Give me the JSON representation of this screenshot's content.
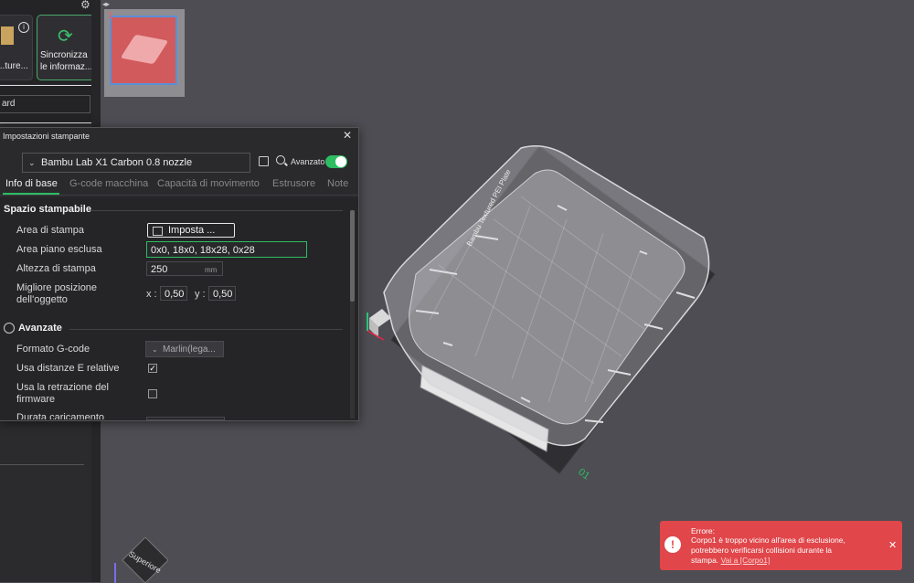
{
  "sidebar": {
    "texture_button_label": "...ture...",
    "sync_button": {
      "line1": "Sincronizza",
      "line2": "le informaz..."
    },
    "name_field_value": "ard"
  },
  "plate": {
    "number": "1"
  },
  "dialog": {
    "title": "Impostazioni stampante",
    "preset": "Bambu Lab X1 Carbon 0.8 nozzle",
    "advanced_label": "Avanzato",
    "advanced_enabled": true,
    "tabs": [
      "Info di base",
      "G-code macchina",
      "Capacità di movimento",
      "Estrusore",
      "Note"
    ],
    "active_tab": "Info di base",
    "sections": {
      "printable_space": {
        "title": "Spazio stampabile",
        "printable_area_label": "Area di stampa",
        "printable_area_button": "Imposta ...",
        "excluded_area_label": "Area piano esclusa",
        "excluded_area_value": "0x0, 18x0, 18x28, 0x28",
        "height_label": "Altezza di stampa",
        "height_value": "250",
        "height_unit": "mm",
        "best_pos_label_1": "Migliore posizione",
        "best_pos_label_2": "dell'oggetto",
        "x_label": "x :",
        "x_value": "0,50",
        "y_label": "y :",
        "y_value": "0,50"
      },
      "advanced": {
        "title": "Avanzate",
        "gcode_flavor_label": "Formato G-code",
        "gcode_flavor_value": "Marlin(lega...",
        "relative_e_label": "Usa distanze E relative",
        "relative_e_checked": true,
        "fw_retraction_label_1": "Usa la retrazione del",
        "fw_retraction_label_2": "firmware",
        "fw_retraction_checked": false,
        "load_time_label": "Durata caricamento"
      }
    }
  },
  "scene": {
    "plate_label": "01",
    "plate_brand": "Bambu Textured PEI Plate",
    "viewcube_label": "Superiore"
  },
  "toast": {
    "title": "Errore:",
    "line1": "Corpo1 è troppo vicino all'area di esclusione,",
    "line2": "potrebbero verificarsi collisioni durante la",
    "line3": "stampa.",
    "link": "Vai a [Corpo1]"
  },
  "colors": {
    "accent": "#2ebd62",
    "error": "#e0464a",
    "background": "#4d4d53"
  }
}
